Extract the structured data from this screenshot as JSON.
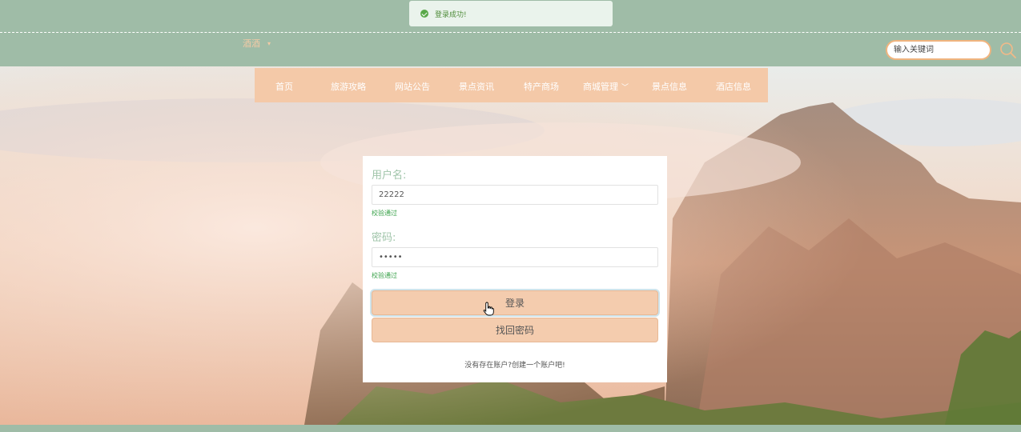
{
  "toast": {
    "message": "登录成功!",
    "icon": "check-circle-icon"
  },
  "user_menu": {
    "username": "酒酒",
    "caret": "▾"
  },
  "search": {
    "placeholder": "输入关键词",
    "icon": "search-icon"
  },
  "nav": {
    "items": [
      {
        "label": "首页"
      },
      {
        "label": "旅游攻略"
      },
      {
        "label": "网站公告"
      },
      {
        "label": "景点资讯"
      },
      {
        "label": "特产商场"
      },
      {
        "label": "商城管理",
        "has_dropdown": true
      },
      {
        "label": "景点信息"
      },
      {
        "label": "酒店信息"
      }
    ]
  },
  "login": {
    "username_label": "用户名:",
    "username_value": "22222",
    "username_status": "校验通过",
    "password_label": "密码:",
    "password_value": "•••••",
    "password_status": "校验通过",
    "login_button": "登录",
    "forgot_button": "找回密码",
    "register_link": "没有存在账户?创建一个账户吧!"
  },
  "colors": {
    "header_bg": "#9fbca7",
    "nav_bg": "#f4c9a8",
    "button_bg": "#f4ccae",
    "label_color": "#9fc4a9",
    "success_color": "#3aa24a",
    "search_border": "#f0b47e"
  }
}
